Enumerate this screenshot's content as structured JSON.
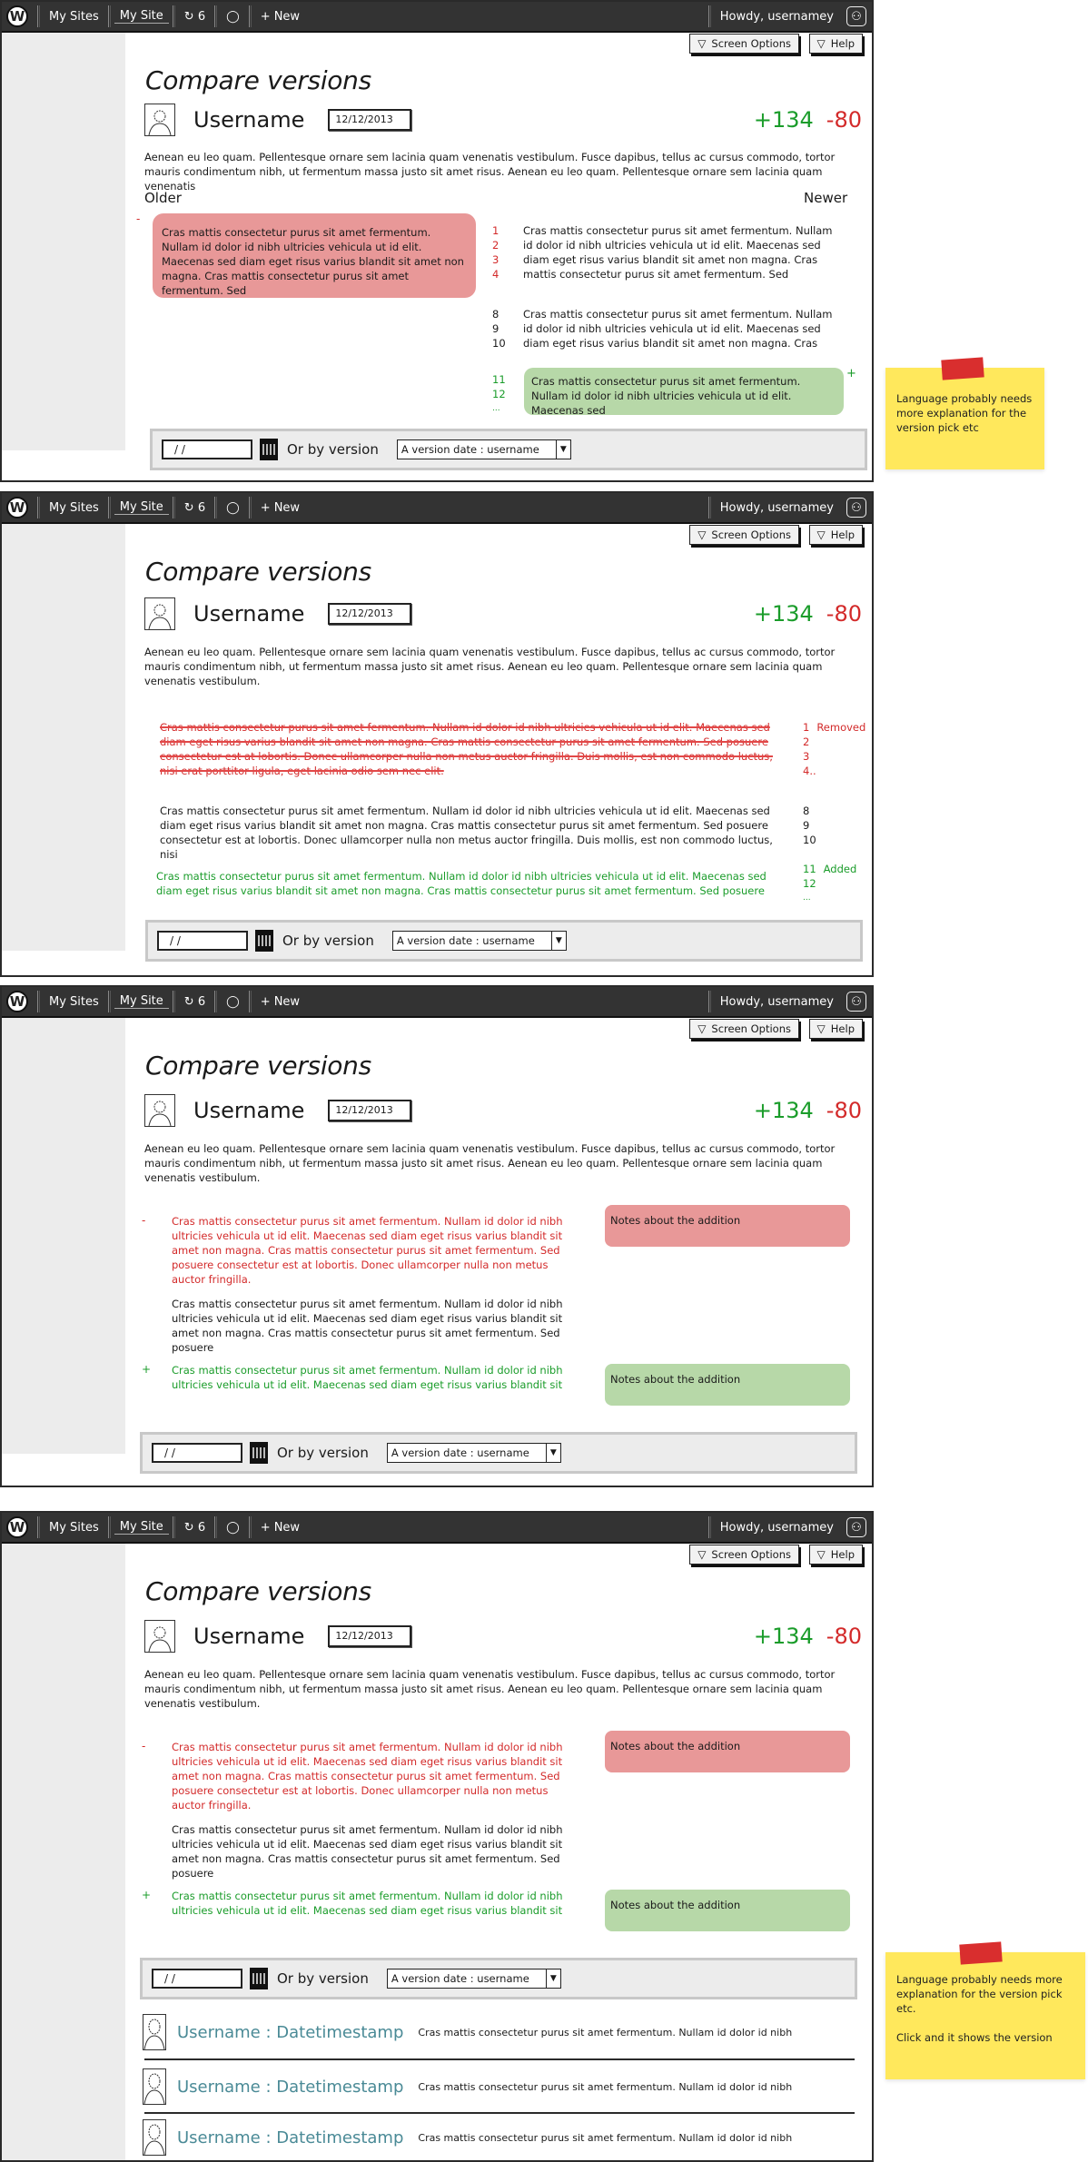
{
  "topbar": {
    "logo": "W",
    "items": [
      "My Sites",
      "My Site",
      "6",
      "+ New"
    ],
    "updates_count": "6",
    "greeting": "Howdy, usernamey"
  },
  "header_buttons": {
    "screen_options": "Screen Options",
    "help": "Help"
  },
  "page": {
    "title": "Compare versions",
    "username": "Username",
    "date": "12/12/2013",
    "additions": "+134",
    "deletions": "-80",
    "intro": "Aenean eu leo quam. Pellentesque ornare sem lacinia quam venenatis vestibulum. Fusce dapibus, tellus ac cursus commodo, tortor mauris condimentum nibh, ut fermentum massa justo sit amet risus. Aenean eu leo quam. Pellentesque ornare sem lacinia quam venenatis",
    "intro_full": "Aenean eu leo quam. Pellentesque ornare sem lacinia quam venenatis vestibulum. Fusce dapibus, tellus ac cursus commodo, tortor mauris condimentum nibh, ut fermentum massa justo sit amet risus. Aenean eu leo quam. Pellentesque ornare sem lacinia quam venenatis vestibulum."
  },
  "filter": {
    "date_value": "/ /",
    "or_label": "Or by version",
    "select_value": "A version date : username"
  },
  "panel1": {
    "older_label": "Older",
    "newer_label": "Newer",
    "minus_mark": "-",
    "plus_mark": "+",
    "removed_text": "Cras mattis consectetur purus sit amet fermentum. Nullam id dolor id nibh ultricies vehicula ut id elit. Maecenas sed diam eget risus varius blandit sit amet non magna. Cras mattis consectetur purus sit amet fermentum. Sed",
    "changed_lines": [
      {
        "num": "1",
        "text": "Cras mattis consectetur purus sit amet fermentum. Nullam"
      },
      {
        "num": "2",
        "text": "id dolor id nibh ultricies vehicula ut id elit. Maecenas sed"
      },
      {
        "num": "3",
        "text": "diam eget risus varius blandit sit amet non magna. Cras"
      },
      {
        "num": "4",
        "text": "mattis consectetur purus sit amet fermentum. Sed"
      }
    ],
    "context_lines": [
      {
        "num": "8",
        "text": "Cras mattis consectetur purus sit amet fermentum. Nullam"
      },
      {
        "num": "9",
        "text": "id dolor id nibh ultricies vehicula ut id elit. Maecenas sed"
      },
      {
        "num": "10",
        "text": "diam eget risus varius blandit sit amet non magna. Cras"
      }
    ],
    "added_nums": [
      "11",
      "12",
      "..."
    ],
    "added_text": "Cras mattis consectetur purus sit amet fermentum. Nullam id dolor id nibh ultricies vehicula ut id elit. Maecenas sed"
  },
  "panel2": {
    "removed_text": "Cras mattis consectetur purus sit amet fermentum. Nullam id dolor id nibh ultricies vehicula ut id elit. Maecenas sed diam eget risus varius blandit sit amet non magna. Cras mattis consectetur purus sit amet fermentum. Sed posuere consectetur est at lobortis. Donec ullamcorper nulla non metus auctor fringilla. Duis mollis, est non commodo luctus, nisi erat porttitor ligula, eget lacinia odio sem nec elit.",
    "removed_nums": [
      "1",
      "2",
      "3",
      "4.."
    ],
    "removed_label": "Removed",
    "context_text": "Cras mattis consectetur purus sit amet fermentum. Nullam id dolor id nibh ultricies vehicula ut id elit. Maecenas sed diam eget risus varius blandit sit amet non magna. Cras mattis consectetur purus sit amet fermentum. Sed posuere consectetur est at lobortis. Donec ullamcorper nulla non metus auctor fringilla. Duis mollis, est non commodo luctus, nisi",
    "context_nums": [
      "8",
      "9",
      "10"
    ],
    "added_text": "Cras mattis consectetur purus sit amet fermentum. Nullam id dolor id nibh ultricies vehicula ut id elit. Maecenas sed diam eget risus varius blandit sit amet non magna. Cras mattis consectetur purus sit amet fermentum. Sed posuere",
    "added_nums": [
      "11",
      "12",
      "..."
    ],
    "added_label": "Added"
  },
  "panel3": {
    "minus_mark": "-",
    "plus_mark": "+",
    "removed_text": "Cras mattis consectetur purus sit amet fermentum. Nullam id dolor id nibh ultricies vehicula ut id elit. Maecenas sed diam eget risus varius blandit sit amet non magna. Cras mattis consectetur purus sit amet fermentum. Sed posuere consectetur est at lobortis. Donec ullamcorper nulla non metus auctor fringilla.",
    "context_text": "Cras mattis consectetur purus sit amet fermentum. Nullam id dolor id nibh ultricies vehicula ut id elit. Maecenas sed diam eget risus varius blandit sit amet non magna. Cras mattis consectetur purus sit amet fermentum. Sed posuere",
    "added_text": "Cras mattis consectetur purus sit amet fermentum. Nullam id dolor id nibh ultricies vehicula ut id elit. Maecenas sed diam eget risus varius blandit sit",
    "note_removed": "Notes about the addition",
    "note_added": "Notes about the addition"
  },
  "versions": [
    {
      "name": "Username : Datetimestamp",
      "text": "Cras mattis consectetur purus sit amet fermentum. Nullam id dolor id nibh"
    },
    {
      "name": "Username : Datetimestamp",
      "text": "Cras mattis consectetur purus sit amet fermentum. Nullam id dolor id nibh"
    },
    {
      "name": "Username : Datetimestamp",
      "text": "Cras mattis consectetur purus sit amet fermentum. Nullam id dolor id nibh"
    }
  ],
  "sticky_notes": [
    {
      "text": "Language probably needs more explanation for the version pick etc"
    },
    {
      "text": "Language probably needs more explanation for the version pick etc.",
      "text2": "Click and it shows the version"
    }
  ],
  "colors": {
    "added": "#1a9c2a",
    "removed": "#d32a2a",
    "removed_bg": "#e89898",
    "added_bg": "#b7d8a8",
    "link": "#4a8a96",
    "sticky": "#ffe85c",
    "topbar": "#333333"
  }
}
